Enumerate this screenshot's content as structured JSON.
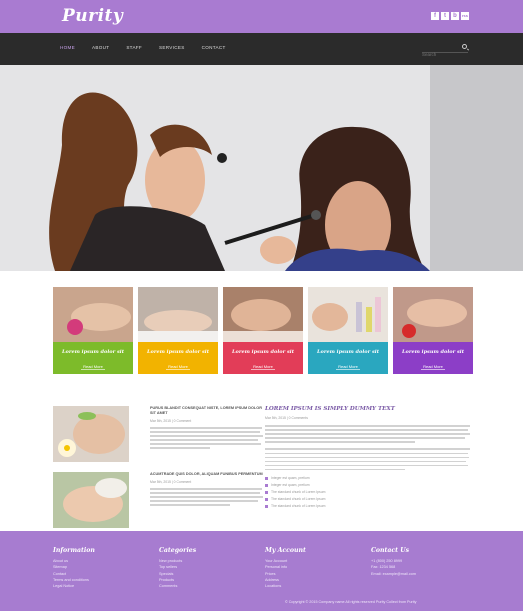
{
  "header": {
    "logo": "Purity",
    "social": [
      "f",
      "t",
      "b",
      "rss"
    ],
    "nav": [
      "HOME",
      "ABOUT",
      "STAFF",
      "SERVICES",
      "CONTACT"
    ],
    "search_placeholder": "Search"
  },
  "cards": [
    {
      "title": "Lorem ipsum dolor sit",
      "more": "Read More",
      "color": "#7dbb2a"
    },
    {
      "title": "Lorem ipsum dolor sit",
      "more": "Read More",
      "color": "#f2b300"
    },
    {
      "title": "Lorem ipsum dolor sit",
      "more": "Read More",
      "color": "#e23d58"
    },
    {
      "title": "Lorem ipsum dolor sit",
      "more": "Read More",
      "color": "#2aa7bf"
    },
    {
      "title": "Lorem ipsum dolor sit",
      "more": "Read More",
      "color": "#8c3ec7"
    }
  ],
  "articles": [
    {
      "title": "PURUS BLANDIT CONSEQUAT NISTE, LOREM IPSUM DOLOR SIT AMET",
      "meta": "Mar 5th, 2015  |  0 Comment"
    },
    {
      "title": "ACUMTRADE QUIS DOLOR, ALIQUAM FUNIBUS PERMENTUM",
      "meta": "Mar 5th, 2015  |  0 Comment"
    }
  ],
  "side": {
    "title": "LOREM IPSUM IS SIMPLY DUMMY TEXT",
    "meta": "Mar 5th, 2015  |  0 Comments",
    "bullets": [
      "Integer est quam, pretium",
      "Integer est quam, pretium",
      "The standard chunk of Lorem Ipsum",
      "The standard chunk of Lorem Ipsum",
      "The standard chunk of Lorem Ipsum"
    ]
  },
  "footer": {
    "columns": [
      {
        "heading": "Information",
        "items": [
          "About us",
          "Sitemap",
          "Contact",
          "Terms and conditions",
          "Legal Notice"
        ]
      },
      {
        "heading": "Categories",
        "items": [
          "New products",
          "Top sellers",
          "Specials",
          "Products",
          "Comments"
        ]
      },
      {
        "heading": "My Account",
        "items": [
          "Your Account",
          "Personal info",
          "Prices",
          "Address",
          "Locations"
        ]
      },
      {
        "heading": "Contact Us",
        "items": [
          "+1 (800) 250 8999",
          "Fax: 1234 568",
          "Email: example@mail.com"
        ]
      }
    ],
    "copyright": "© Copyright © 2015 Company name All rights reserved Purity  Collect from Purity"
  }
}
